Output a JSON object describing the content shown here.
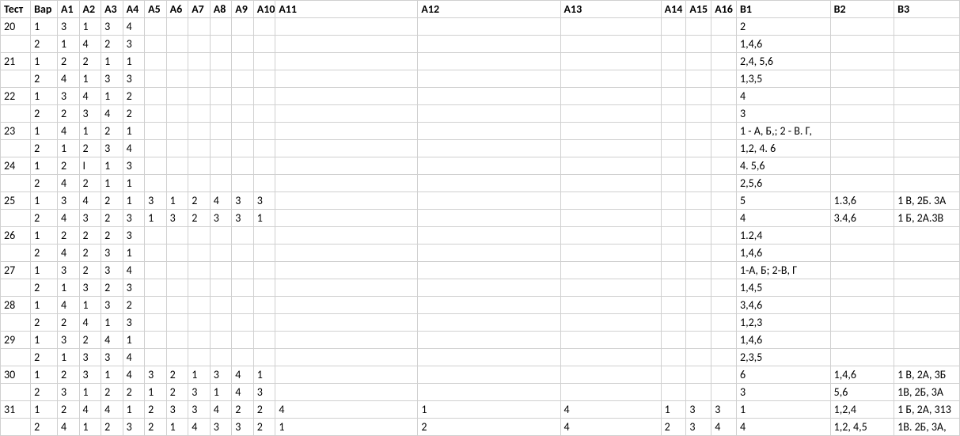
{
  "columns": [
    "Тест",
    "Вар",
    "A1",
    "A2",
    "A3",
    "A4",
    "A5",
    "A6",
    "A7",
    "A8",
    "A9",
    "A10",
    "A11",
    "A12",
    "A13",
    "A14",
    "A15",
    "A16",
    "B1",
    "B2",
    "B3"
  ],
  "col_keys": [
    "test",
    "var",
    "a1",
    "a2",
    "a3",
    "a4",
    "a5",
    "a6",
    "a7",
    "a8",
    "a9",
    "a10",
    "a11",
    "a12",
    "a13",
    "a14",
    "a15",
    "a16",
    "b1",
    "b2",
    "b3"
  ],
  "col_classes": [
    "c-test",
    "c-var",
    "c-a",
    "c-a",
    "c-a",
    "c-a",
    "c-a",
    "c-a",
    "c-a",
    "c-a",
    "c-a",
    "c-a",
    "c-a11",
    "c-a12",
    "c-a13",
    "c-a14",
    "c-a15",
    "c-a16",
    "c-b1",
    "c-b2",
    "c-b3"
  ],
  "rows": [
    {
      "test": "20",
      "var": "1",
      "a1": "3",
      "a2": "1",
      "a3": "3",
      "a4": "4",
      "b1": "2"
    },
    {
      "test": "",
      "var": "2",
      "a1": "1",
      "a2": "4",
      "a3": "2",
      "a4": "3",
      "b1": "1,4,6"
    },
    {
      "test": "21",
      "var": "1",
      "a1": "2",
      "a2": "2",
      "a3": "1",
      "a4": "1",
      "b1": "2,4, 5,6"
    },
    {
      "test": "",
      "var": "2",
      "a1": "4",
      "a2": "1",
      "a3": "3",
      "a4": "3",
      "b1": "1,3,5"
    },
    {
      "test": "22",
      "var": "1",
      "a1": "3",
      "a2": "4",
      "a3": "1",
      "a4": "2",
      "b1": "4"
    },
    {
      "test": "",
      "var": "2",
      "a1": "2",
      "a2": "3",
      "a3": "4",
      "a4": "2",
      "b1": "3"
    },
    {
      "test": "23",
      "var": "1",
      "a1": "4",
      "a2": "1",
      "a3": "2",
      "a4": "1",
      "b1": "1 - А, Б,; 2  - В. Г,"
    },
    {
      "test": "",
      "var": "2",
      "a1": "1",
      "a2": "2",
      "a3": "3",
      "a4": "4",
      "b1": "1,2, 4. 6"
    },
    {
      "test": "24",
      "var": "1",
      "a1": "2",
      "a2": "I",
      "a3": "1",
      "a4": "3",
      "b1": "4. 5,6"
    },
    {
      "test": "",
      "var": "2",
      "a1": "4",
      "a2": "2",
      "a3": "1",
      "a4": "1",
      "b1": "2,5,6"
    },
    {
      "test": "25",
      "var": "1",
      "a1": "3",
      "a2": "4",
      "a3": "2",
      "a4": "1",
      "a5": "3",
      "a6": "1",
      "a7": "2",
      "a8": "4",
      "a9": "3",
      "a10": "3",
      "b1": "5",
      "b2": "1.3,6",
      "b3": "1 В, 2Б. 3А"
    },
    {
      "test": "",
      "var": "2",
      "a1": "4",
      "a2": "3",
      "a3": "2",
      "a4": "3",
      "a5": "1",
      "a6": "3",
      "a7": "2",
      "a8": "3",
      "a9": "3",
      "a10": "1",
      "b1": "4",
      "b2": "3.4,6",
      "b3": "1 Б, 2А.3В"
    },
    {
      "test": "26",
      "var": "1",
      "a1": "2",
      "a2": "2",
      "a3": "2",
      "a4": "3",
      "b1": "1.2,4"
    },
    {
      "test": "",
      "var": "2",
      "a1": "4",
      "a2": "2",
      "a3": "3",
      "a4": "1",
      "b1": "1,4,6"
    },
    {
      "test": "27",
      "var": "1",
      "a1": "3",
      "a2": "2",
      "a3": "3",
      "a4": "4",
      "b1": "1-А, Б; 2-В, Г"
    },
    {
      "test": "",
      "var": "2",
      "a1": "1",
      "a2": "3",
      "a3": "2",
      "a4": "3",
      "b1": "1,4,5"
    },
    {
      "test": "28",
      "var": "1",
      "a1": "4",
      "a2": "1",
      "a3": "3",
      "a4": "2",
      "b1": "3,4,6"
    },
    {
      "test": "",
      "var": "2",
      "a1": "2",
      "a2": "4",
      "a3": "1",
      "a4": "3",
      "b1": "1,2,3"
    },
    {
      "test": "29",
      "var": "1",
      "a1": "3",
      "a2": "2",
      "a3": "4",
      "a4": "1",
      "b1": "1,4,6"
    },
    {
      "test": "",
      "var": "2",
      "a1": "1",
      "a2": "3",
      "a3": "3",
      "a4": "4",
      "b1": "2,3,5"
    },
    {
      "test": "30",
      "var": "1",
      "a1": "2",
      "a2": "3",
      "a3": "1",
      "a4": "4",
      "a5": "3",
      "a6": "2",
      "a7": "1",
      "a8": "3",
      "a9": "4",
      "a10": "1",
      "b1": "6",
      "b2": "1,4,6",
      "b3": "1 В, 2А, 3Б"
    },
    {
      "test": "",
      "var": "2",
      "a1": "3",
      "a2": "1",
      "a3": "2",
      "a4": "2",
      "a5": "1",
      "a6": "2",
      "a7": "3",
      "a8": "1",
      "a9": "4",
      "a10": "3",
      "b1": "3",
      "b2": "5,6",
      "b3": "1В, 2Б, 3А"
    },
    {
      "test": "31",
      "var": "1",
      "a1": "2",
      "a2": "4",
      "a3": "4",
      "a4": "1",
      "a5": "2",
      "a6": "3",
      "a7": "3",
      "a8": "4",
      "a9": "2",
      "a10": "2",
      "a11": "4",
      "a12": "1",
      "a13": "4",
      "a14": "1",
      "a15": "3",
      "a16": "3",
      "b1": "1",
      "b2": "1,2,4",
      "b3": "1 Б, 2А, 313"
    },
    {
      "test": "",
      "var": "2",
      "a1": "4",
      "a2": "1",
      "a3": "2",
      "a4": "3",
      "a5": "2",
      "a6": "1",
      "a7": "4",
      "a8": "3",
      "a9": "3",
      "a10": "2",
      "a11": "1",
      "a12": "2",
      "a13": "4",
      "a14": "2",
      "a15": "3",
      "a16": "4",
      "b1": "4",
      "b2": "1,2, 4,5",
      "b3": "1В. 2Б, 3А,"
    }
  ]
}
